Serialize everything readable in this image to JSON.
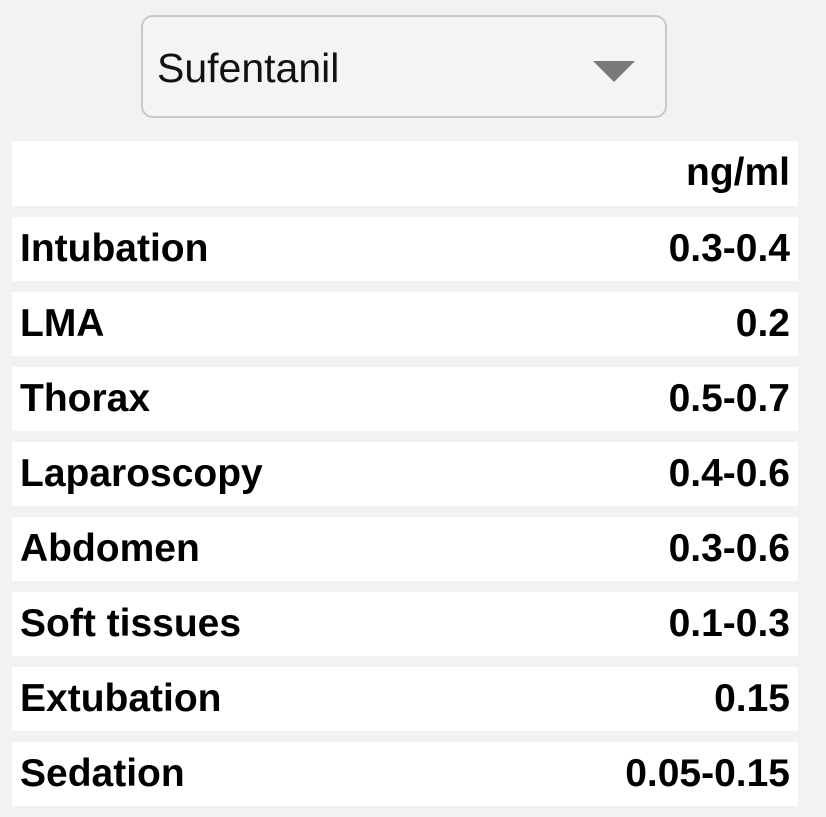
{
  "drug_select": {
    "selected": "Sufentanil",
    "icon": "chevron-down-icon"
  },
  "table": {
    "unit_header": "ng/ml",
    "rows": [
      {
        "label": "Intubation",
        "value": "0.3-0.4"
      },
      {
        "label": "LMA",
        "value": "0.2"
      },
      {
        "label": "Thorax",
        "value": "0.5-0.7"
      },
      {
        "label": "Laparoscopy",
        "value": "0.4-0.6"
      },
      {
        "label": "Abdomen",
        "value": "0.3-0.6"
      },
      {
        "label": "Soft tissues",
        "value": "0.1-0.3"
      },
      {
        "label": "Extubation",
        "value": "0.15"
      },
      {
        "label": "Sedation",
        "value": "0.05-0.15"
      }
    ]
  }
}
